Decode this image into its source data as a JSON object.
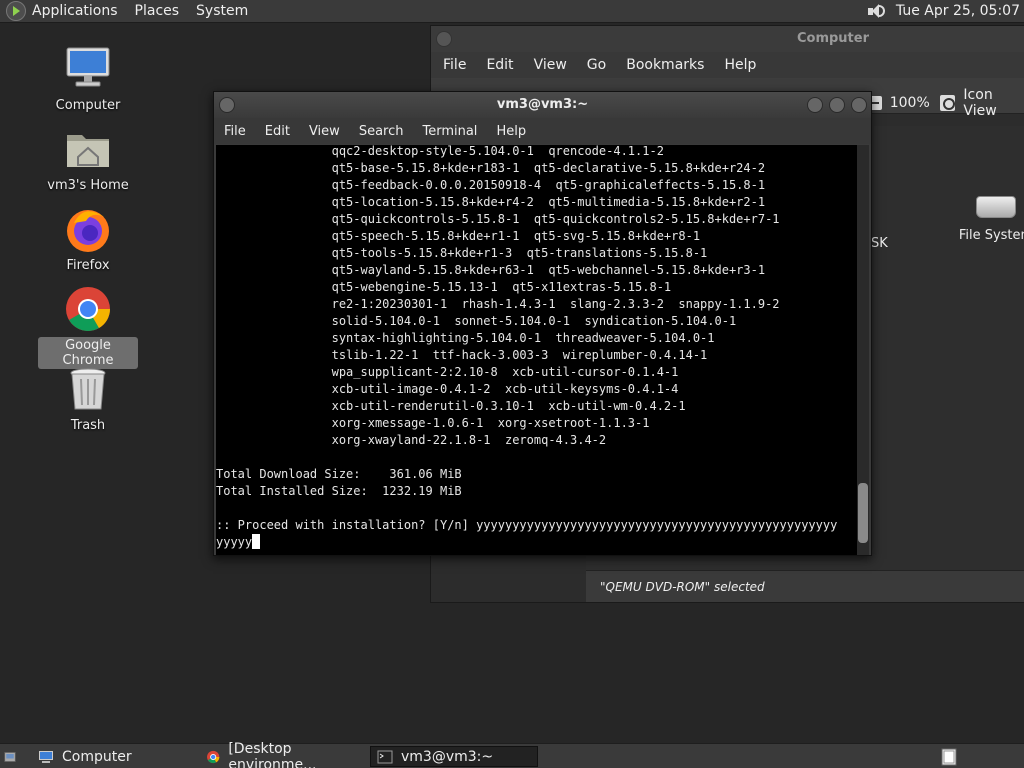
{
  "top_panel": {
    "menus": [
      "Applications",
      "Places",
      "System"
    ],
    "clock": "Tue Apr 25, 05:07"
  },
  "desktop_icons": [
    {
      "label": "Computer"
    },
    {
      "label": "vm3's Home"
    },
    {
      "label": "Firefox"
    },
    {
      "label": "Google Chrome"
    },
    {
      "label": "Trash"
    }
  ],
  "file_manager": {
    "title": "Computer",
    "menus": [
      "File",
      "Edit",
      "View",
      "Go",
      "Bookmarks",
      "Help"
    ],
    "zoom": "100%",
    "view_mode": "Icon View",
    "items": [
      "SK",
      "File System"
    ],
    "status": "\"QEMU DVD-ROM\" selected"
  },
  "terminal": {
    "title": "vm3@vm3:~",
    "menus": [
      "File",
      "Edit",
      "View",
      "Search",
      "Terminal",
      "Help"
    ],
    "output": "                qqc2-desktop-style-5.104.0-1  qrencode-4.1.1-2\n                qt5-base-5.15.8+kde+r183-1  qt5-declarative-5.15.8+kde+r24-2\n                qt5-feedback-0.0.0.20150918-4  qt5-graphicaleffects-5.15.8-1\n                qt5-location-5.15.8+kde+r4-2  qt5-multimedia-5.15.8+kde+r2-1\n                qt5-quickcontrols-5.15.8-1  qt5-quickcontrols2-5.15.8+kde+r7-1\n                qt5-speech-5.15.8+kde+r1-1  qt5-svg-5.15.8+kde+r8-1\n                qt5-tools-5.15.8+kde+r1-3  qt5-translations-5.15.8-1\n                qt5-wayland-5.15.8+kde+r63-1  qt5-webchannel-5.15.8+kde+r3-1\n                qt5-webengine-5.15.13-1  qt5-x11extras-5.15.8-1\n                re2-1:20230301-1  rhash-1.4.3-1  slang-2.3.3-2  snappy-1.1.9-2\n                solid-5.104.0-1  sonnet-5.104.0-1  syndication-5.104.0-1\n                syntax-highlighting-5.104.0-1  threadweaver-5.104.0-1\n                tslib-1.22-1  ttf-hack-3.003-3  wireplumber-0.4.14-1\n                wpa_supplicant-2:2.10-8  xcb-util-cursor-0.1.4-1\n                xcb-util-image-0.4.1-2  xcb-util-keysyms-0.4.1-4\n                xcb-util-renderutil-0.3.10-1  xcb-util-wm-0.4.2-1\n                xorg-xmessage-1.0.6-1  xorg-xsetroot-1.1.3-1\n                xorg-xwayland-22.1.8-1  zeromq-4.3.4-2\n\nTotal Download Size:    361.06 MiB\nTotal Installed Size:  1232.19 MiB\n\n:: Proceed with installation? [Y/n] yyyyyyyyyyyyyyyyyyyyyyyyyyyyyyyyyyyyyyyyyyyyyyyyyy\nyyyyy"
  },
  "taskbar": [
    {
      "label": "Computer"
    },
    {
      "label": "[Desktop environme..."
    },
    {
      "label": "vm3@vm3:~"
    }
  ]
}
